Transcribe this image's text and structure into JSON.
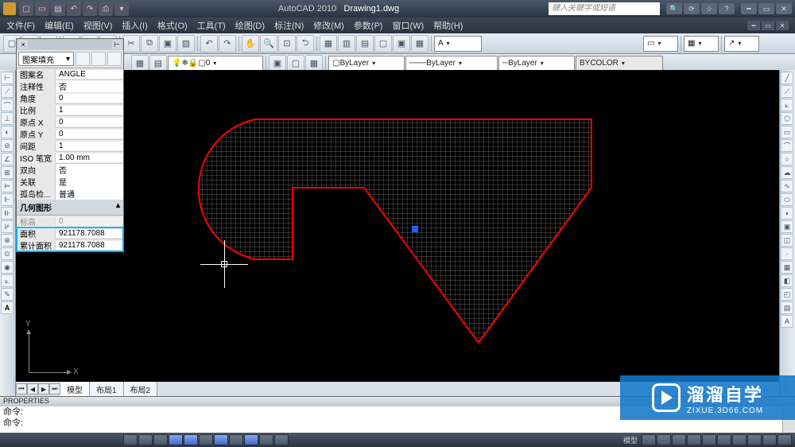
{
  "app": {
    "name": "AutoCAD 2010",
    "document": "Drawing1.dwg"
  },
  "search_placeholder": "键入关键字或短语",
  "menus": [
    "文件(F)",
    "编辑(E)",
    "视图(V)",
    "插入(I)",
    "格式(O)",
    "工具(T)",
    "绘图(D)",
    "标注(N)",
    "修改(M)",
    "参数(P)",
    "窗口(W)",
    "帮助(H)"
  ],
  "layer_combo": "0",
  "color_combo": "ByLayer",
  "linetype_combo": "ByLayer",
  "lineweight_combo": "ByLayer",
  "plotstyle_combo": "BYCOLOR",
  "properties": {
    "selection_type": "图案填充",
    "rows": [
      {
        "label": "图案名",
        "value": "ANGLE"
      },
      {
        "label": "注释性",
        "value": "否"
      },
      {
        "label": "角度",
        "value": "0"
      },
      {
        "label": "比例",
        "value": "1"
      },
      {
        "label": "原点 X",
        "value": "0"
      },
      {
        "label": "原点 Y",
        "value": "0"
      },
      {
        "label": "间距",
        "value": "1"
      },
      {
        "label": "ISO 笔宽",
        "value": "1.00 mm"
      },
      {
        "label": "双向",
        "value": "否"
      },
      {
        "label": "关联",
        "value": "是"
      },
      {
        "label": "孤岛检...",
        "value": "普通"
      }
    ],
    "section_geometry": "几何图形",
    "hidden_row_label": "标高",
    "hidden_row_value": "0",
    "area_rows": [
      {
        "label": "面积",
        "value": "921178.7088"
      },
      {
        "label": "累计面积",
        "value": "921178.7088"
      }
    ]
  },
  "ucs": {
    "x_label": "X",
    "y_label": "Y"
  },
  "tabs": {
    "model": "模型",
    "layout1": "布局1",
    "layout2": "布局2"
  },
  "commandline": {
    "title": "PROPERTIES",
    "line1": "命令:",
    "line2": "命令:"
  },
  "statusbar": {
    "model_btn": "模型"
  },
  "watermark": {
    "title": "溜溜自学",
    "url": "ZIXUE.3D66.COM"
  },
  "chart_data": {
    "type": "diagram",
    "note": "CAD drawing: closed polyline with arc fillet on left side, hatched with ANGLE pattern, red outline, single blue grip near centroid region",
    "boundary_color": "#ff0000",
    "hatch_pattern": "ANGLE",
    "area": 921178.7088
  }
}
